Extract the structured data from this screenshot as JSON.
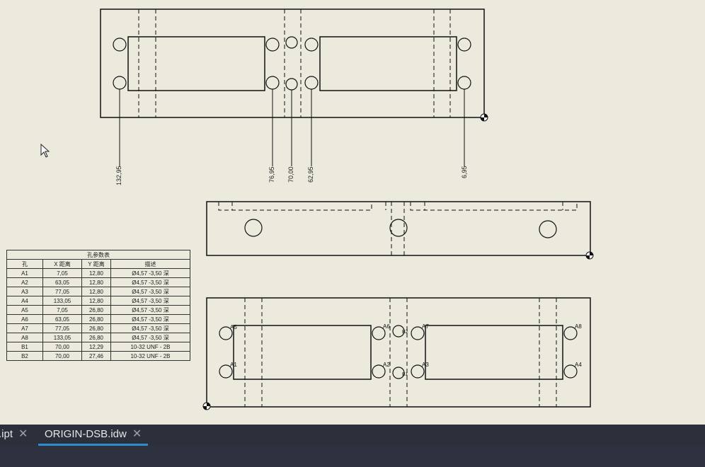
{
  "drawing": {
    "dimensions": [
      "132,95",
      "76,95",
      "70,00",
      "62,95",
      "6,95"
    ],
    "hole_tags": [
      "A1",
      "A2",
      "A3",
      "A4",
      "A5",
      "A6",
      "A7",
      "A8",
      "B1",
      "B2"
    ]
  },
  "hole_table": {
    "title": "孔参数表",
    "headers": [
      "孔",
      "X 距离",
      "Y 距离",
      "描述"
    ],
    "rows": [
      [
        "A1",
        "7,05",
        "12,80",
        "Ø4,57 -3,50 深"
      ],
      [
        "A2",
        "63,05",
        "12,80",
        "Ø4,57 -3,50 深"
      ],
      [
        "A3",
        "77,05",
        "12,80",
        "Ø4,57 -3,50 深"
      ],
      [
        "A4",
        "133,05",
        "12,80",
        "Ø4,57 -3,50 深"
      ],
      [
        "A5",
        "7,05",
        "26,80",
        "Ø4,57 -3,50 深"
      ],
      [
        "A6",
        "63,05",
        "26,80",
        "Ø4,57 -3,50 深"
      ],
      [
        "A7",
        "77,05",
        "26,80",
        "Ø4,57 -3,50 深"
      ],
      [
        "A8",
        "133,05",
        "26,80",
        "Ø4,57 -3,50 深"
      ],
      [
        "B1",
        "70,00",
        "12,29",
        "10-32 UNF - 2B"
      ],
      [
        "B2",
        "70,00",
        "27,46",
        "10-32 UNF - 2B"
      ]
    ]
  },
  "tabs": [
    {
      "label": ".ipt",
      "active": false
    },
    {
      "label": "ORIGIN-DSB.idw",
      "active": true
    }
  ],
  "icons": {
    "close": "close-icon",
    "cursor": "mouse-pointer-icon"
  },
  "colors": {
    "sheet": "#ece9dd",
    "tabbar": "#2b303b",
    "active_tab_underline": "#2f8bd0"
  }
}
